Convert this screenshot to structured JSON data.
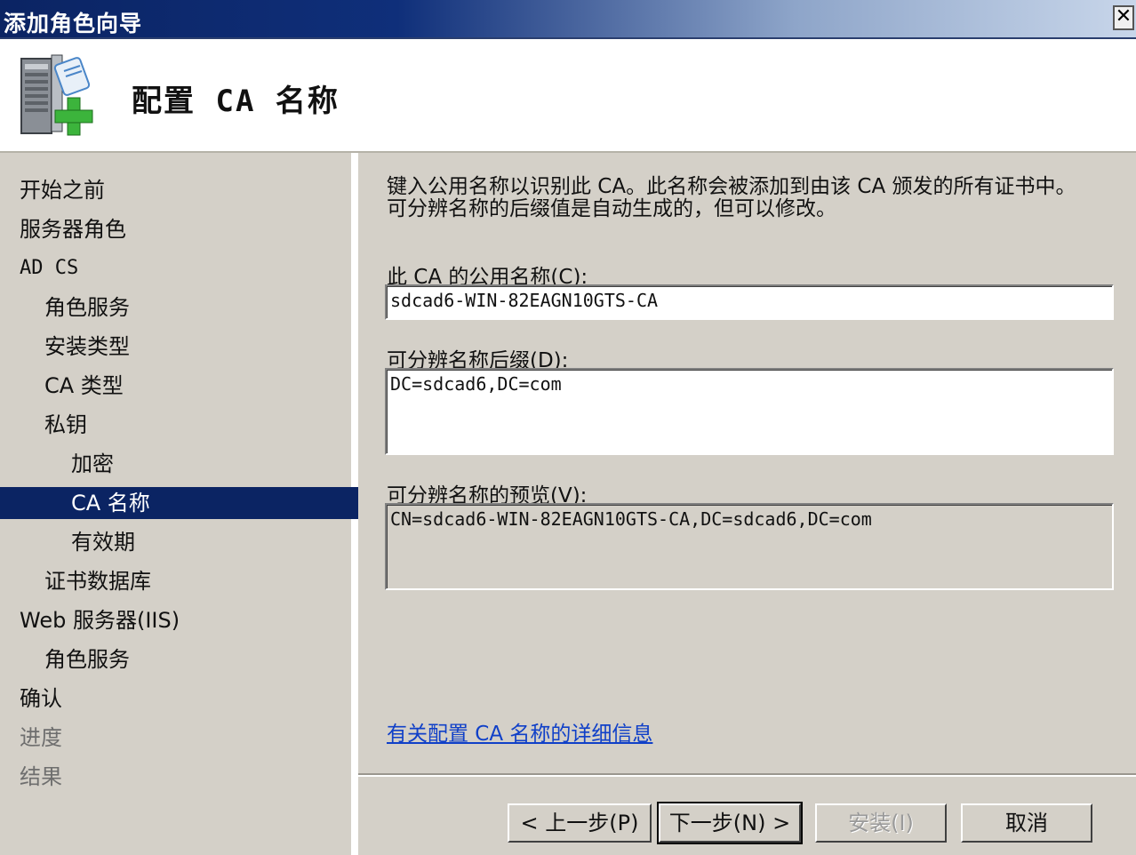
{
  "window": {
    "title": "添加角色向导",
    "close_label": "✕"
  },
  "header": {
    "title": "配置 CA 名称",
    "icon": "server-add-role-icon"
  },
  "sidebar": {
    "items": [
      {
        "label": "开始之前"
      },
      {
        "label": "服务器角色"
      },
      {
        "label": "AD CS"
      },
      {
        "label": "角色服务"
      },
      {
        "label": "安装类型"
      },
      {
        "label": "CA 类型"
      },
      {
        "label": "私钥"
      },
      {
        "label": "加密"
      },
      {
        "label": "CA 名称",
        "selected": true
      },
      {
        "label": "有效期"
      },
      {
        "label": "证书数据库"
      },
      {
        "label": "Web 服务器(IIS)"
      },
      {
        "label": "角色服务"
      },
      {
        "label": "确认"
      },
      {
        "label": "进度",
        "disabled": true
      },
      {
        "label": "结果",
        "disabled": true
      }
    ]
  },
  "main": {
    "description_line1": "键入公用名称以识别此 CA。此名称会被添加到由该 CA 颁发的所有证书中。",
    "description_line2": "可分辨名称的后缀值是自动生成的，但可以修改。",
    "common_name_label": "此 CA 的公用名称(C):",
    "common_name_value": "sdcad6-WIN-82EAGN10GTS-CA",
    "dn_suffix_label": "可分辨名称后缀(D):",
    "dn_suffix_value": "DC=sdcad6,DC=com",
    "dn_preview_label": "可分辨名称的预览(V):",
    "dn_preview_value": "CN=sdcad6-WIN-82EAGN10GTS-CA,DC=sdcad6,DC=com",
    "help_link": "有关配置 CA 名称的详细信息"
  },
  "footer": {
    "prev_label": "< 上一步(P)",
    "next_label": "下一步(N) >",
    "install_label": "安装(I)",
    "cancel_label": "取消"
  }
}
